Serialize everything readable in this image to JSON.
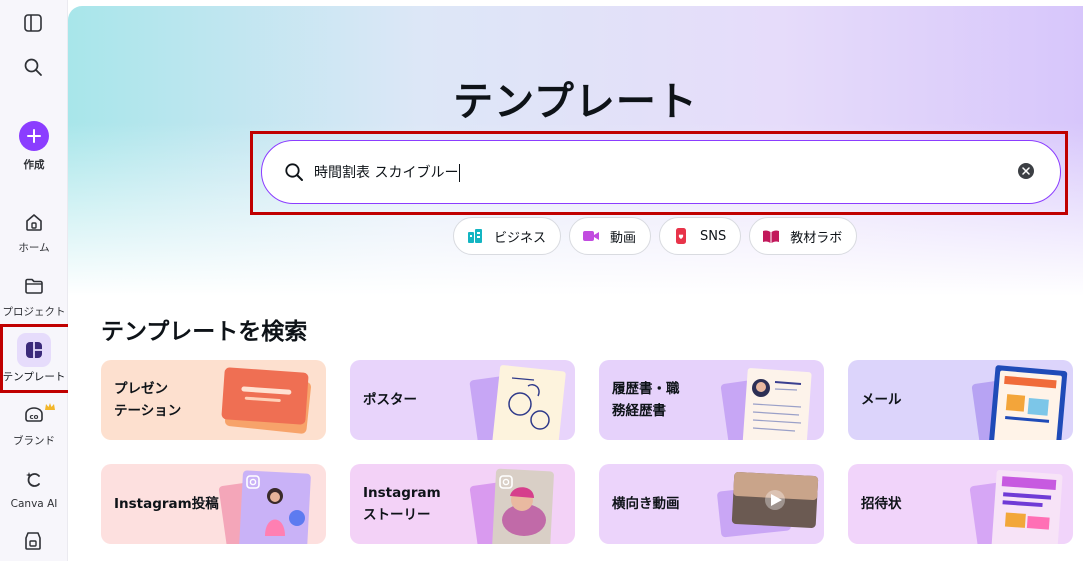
{
  "sidebar": {
    "create_label": "作成",
    "items": [
      {
        "label": "ホーム",
        "icon": "home-icon"
      },
      {
        "label": "プロジェクト",
        "icon": "folder-icon"
      },
      {
        "label": "テンプレート",
        "icon": "template-icon"
      },
      {
        "label": "ブランド",
        "icon": "brand-icon"
      },
      {
        "label": "Canva AI",
        "icon": "canva-ai-icon"
      }
    ]
  },
  "hero": {
    "title": "テンプレート"
  },
  "search": {
    "value": "時間割表 スカイブルー"
  },
  "chips": [
    {
      "label": "ビジネス",
      "icon": "business-icon",
      "color": "#13b5c2"
    },
    {
      "label": "動画",
      "icon": "video-icon",
      "color": "#c24ce0"
    },
    {
      "label": "SNS",
      "icon": "sns-icon",
      "color": "#e8344a"
    },
    {
      "label": "教材ラボ",
      "icon": "book-icon",
      "color": "#c2185b"
    }
  ],
  "section": {
    "title": "テンプレートを検索"
  },
  "categories": [
    {
      "label": "プレゼン\nテーション",
      "bg": "#fde0cf"
    },
    {
      "label": "ポスター",
      "bg": "#e8d4fb"
    },
    {
      "label": "履歴書・職\n務経歴書",
      "bg": "#e6d2fb"
    },
    {
      "label": "メール",
      "bg": "#dcd4fb"
    },
    {
      "label": "Instagram投稿",
      "bg": "#fde0df"
    },
    {
      "label": "Instagram\nストーリー",
      "bg": "#f3d2f7"
    },
    {
      "label": "横向き動画",
      "bg": "#ecd4fb"
    },
    {
      "label": "招待状",
      "bg": "#f1d4fa"
    }
  ],
  "colors": {
    "accent": "#8b3dff",
    "highlight_box": "#c00000"
  }
}
